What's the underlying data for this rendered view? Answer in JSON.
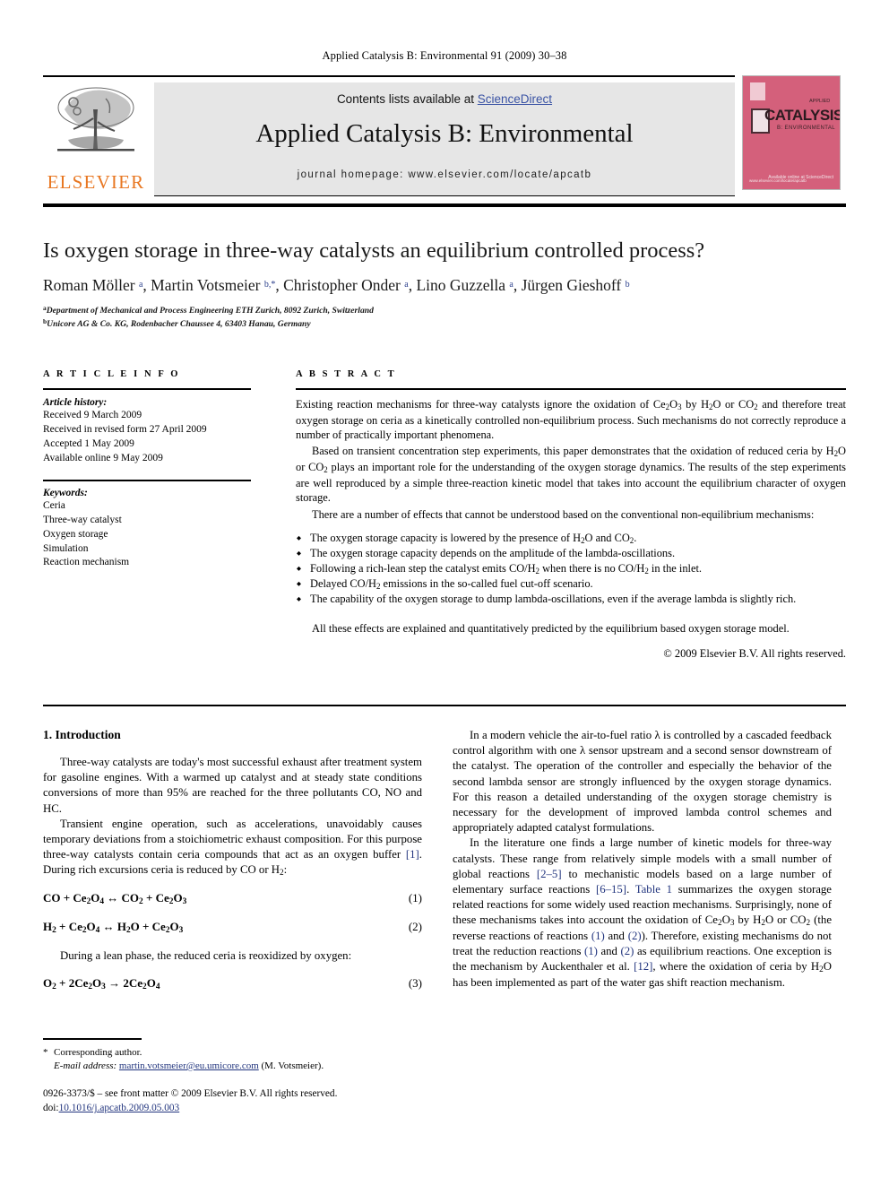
{
  "running_head": "Applied Catalysis B: Environmental 91 (2009) 30–38",
  "masthead": {
    "contents_prefix": "Contents lists available at ",
    "sciencedirect": "ScienceDirect",
    "journal_title": "Applied Catalysis B: Environmental",
    "homepage": "journal homepage: www.elsevier.com/locate/apcatb",
    "elsevier_wordmark": "ELSEVIER",
    "elsevier_orange": "#E87722",
    "sciencedirect_blue": "#3A53A4",
    "cover": {
      "title": "CATALYSIS",
      "subtitle": "B: ENVIRONMENTAL",
      "kicker": "APPLIED",
      "footer_right": "Available online at\nScienceDirect",
      "footer_left": "www.elsevier.com/locate/apcatb",
      "background": "#D4607B"
    }
  },
  "article": {
    "title": "Is oxygen storage in three-way catalysts an equilibrium controlled process?",
    "authors_html": "Roman Möller <sup>a</sup>, Martin Votsmeier <sup>b,*</sup>, Christopher Onder <sup>a</sup>, Lino Guzzella <sup>a</sup>, Jürgen Gieshoff <sup>b</sup>",
    "affiliations": [
      "Department of Mechanical and Process Engineering ETH Zurich, 8092 Zurich, Switzerland",
      "Unicore AG & Co. KG, Rodenbacher Chaussee 4, 63403 Hanau, Germany"
    ],
    "affiliation_marks": [
      "a",
      "b"
    ]
  },
  "article_info": {
    "section_label": "A R T I C L E   I N F O",
    "history_head": "Article history:",
    "history": [
      "Received 9 March 2009",
      "Received in revised form 27 April 2009",
      "Accepted 1 May 2009",
      "Available online 9 May 2009"
    ],
    "keywords_head": "Keywords:",
    "keywords": [
      "Ceria",
      "Three-way catalyst",
      "Oxygen storage",
      "Simulation",
      "Reaction mechanism"
    ]
  },
  "abstract": {
    "section_label": "A B S T R A C T",
    "paragraphs": [
      "Existing reaction mechanisms for three-way catalysts ignore the oxidation of Ce<sub>2</sub>O<sub>3</sub> by H<sub>2</sub>O or CO<sub>2</sub> and therefore treat oxygen storage on ceria as a kinetically controlled non-equilibrium process. Such mechanisms do not correctly reproduce a number of practically important phenomena.",
      "Based on transient concentration step experiments, this paper demonstrates that the oxidation of reduced ceria by H<sub>2</sub>O or CO<sub>2</sub> plays an important role for the understanding of the oxygen storage dynamics. The results of the step experiments are well reproduced by a simple three-reaction kinetic model that takes into account the equilibrium character of oxygen storage.",
      "There are a number of effects that cannot be understood based on the conventional non-equilibrium mechanisms:"
    ],
    "bullets": [
      "The oxygen storage capacity is lowered by the presence of H<sub>2</sub>O and CO<sub>2</sub>.",
      "The oxygen storage capacity depends on the amplitude of the lambda-oscillations.",
      "Following a rich-lean step the catalyst emits CO/H<sub>2</sub> when there is no CO/H<sub>2</sub> in the inlet.",
      "Delayed CO/H<sub>2</sub> emissions in the so-called fuel cut-off scenario.",
      "The capability of the oxygen storage to dump lambda-oscillations, even if the average lambda is slightly rich."
    ],
    "closing": "All these effects are explained and quantitatively predicted by the equilibrium based oxygen storage model.",
    "copyright": "© 2009 Elsevier B.V. All rights reserved."
  },
  "body": {
    "heading": "1. Introduction",
    "left_paragraphs": [
      "Three-way catalysts are today's most successful exhaust after treatment system for gasoline engines. With a warmed up catalyst and at steady state conditions conversions of more than 95% are reached for the three pollutants CO, NO and HC.",
      "Transient engine operation, such as accelerations, unavoidably causes temporary deviations from a stoichiometric exhaust composition. For this purpose three-way catalysts contain ceria compounds that act as an oxygen buffer <span class=\"ref\">[1]</span>. During rich excursions ceria is reduced by CO or H<sub>2</sub>:"
    ],
    "equations": [
      {
        "body": "CO + Ce<sub>2</sub>O<sub>4</sub> ↔ CO<sub>2</sub> + Ce<sub>2</sub>O<sub>3</sub>",
        "number": "(1)"
      },
      {
        "body": "H<sub>2</sub> + Ce<sub>2</sub>O<sub>4</sub> ↔ H<sub>2</sub>O + Ce<sub>2</sub>O<sub>3</sub>",
        "number": "(2)"
      },
      {
        "body": "O<sub>2</sub> + 2Ce<sub>2</sub>O<sub>3</sub> → 2Ce<sub>2</sub>O<sub>4</sub>",
        "number": "(3)"
      }
    ],
    "lean_paragraph": "During a lean phase, the reduced ceria is reoxidized by oxygen:",
    "right_paragraphs": [
      "In a modern vehicle the air-to-fuel ratio λ is controlled by a cascaded feedback control algorithm with one λ sensor upstream and a second sensor downstream of the catalyst. The operation of the controller and especially the behavior of the second lambda sensor are strongly influenced by the oxygen storage dynamics. For this reason a detailed understanding of the oxygen storage chemistry is necessary for the development of improved lambda control schemes and appropriately adapted catalyst formulations.",
      "In the literature one finds a large number of kinetic models for three-way catalysts. These range from relatively simple models with a small number of global reactions <span class=\"ref\">[2–5]</span> to mechanistic models based on a large number of elementary surface reactions <span class=\"ref\">[6–15]</span>. <span class=\"ref\">Table 1</span> summarizes the oxygen storage related reactions for some widely used reaction mechanisms. Surprisingly, none of these mechanisms takes into account the oxidation of Ce<sub>2</sub>O<sub>3</sub> by H<sub>2</sub>O or CO<sub>2</sub> (the reverse reactions of reactions <span class=\"ref\">(1)</span> and <span class=\"ref\">(2)</span>). Therefore, existing mechanisms do not treat the reduction reactions <span class=\"ref\">(1)</span> and <span class=\"ref\">(2)</span> as equilibrium reactions. One exception is the mechanism by Auckenthaler et al. <span class=\"ref\">[12]</span>, where the oxidation of ceria by H<sub>2</sub>O has been implemented as part of the water gas shift reaction mechanism."
    ]
  },
  "footnote": {
    "star": "*",
    "corresponding": "Corresponding author.",
    "email_label": "E-mail address:",
    "email": "martin.votsmeier@eu.umicore.com",
    "email_suffix": "(M. Votsmeier)."
  },
  "imprint": {
    "issn_line": "0926-3373/$ – see front matter © 2009 Elsevier B.V. All rights reserved.",
    "doi_prefix": "doi:",
    "doi": "10.1016/j.apcatb.2009.05.003"
  }
}
